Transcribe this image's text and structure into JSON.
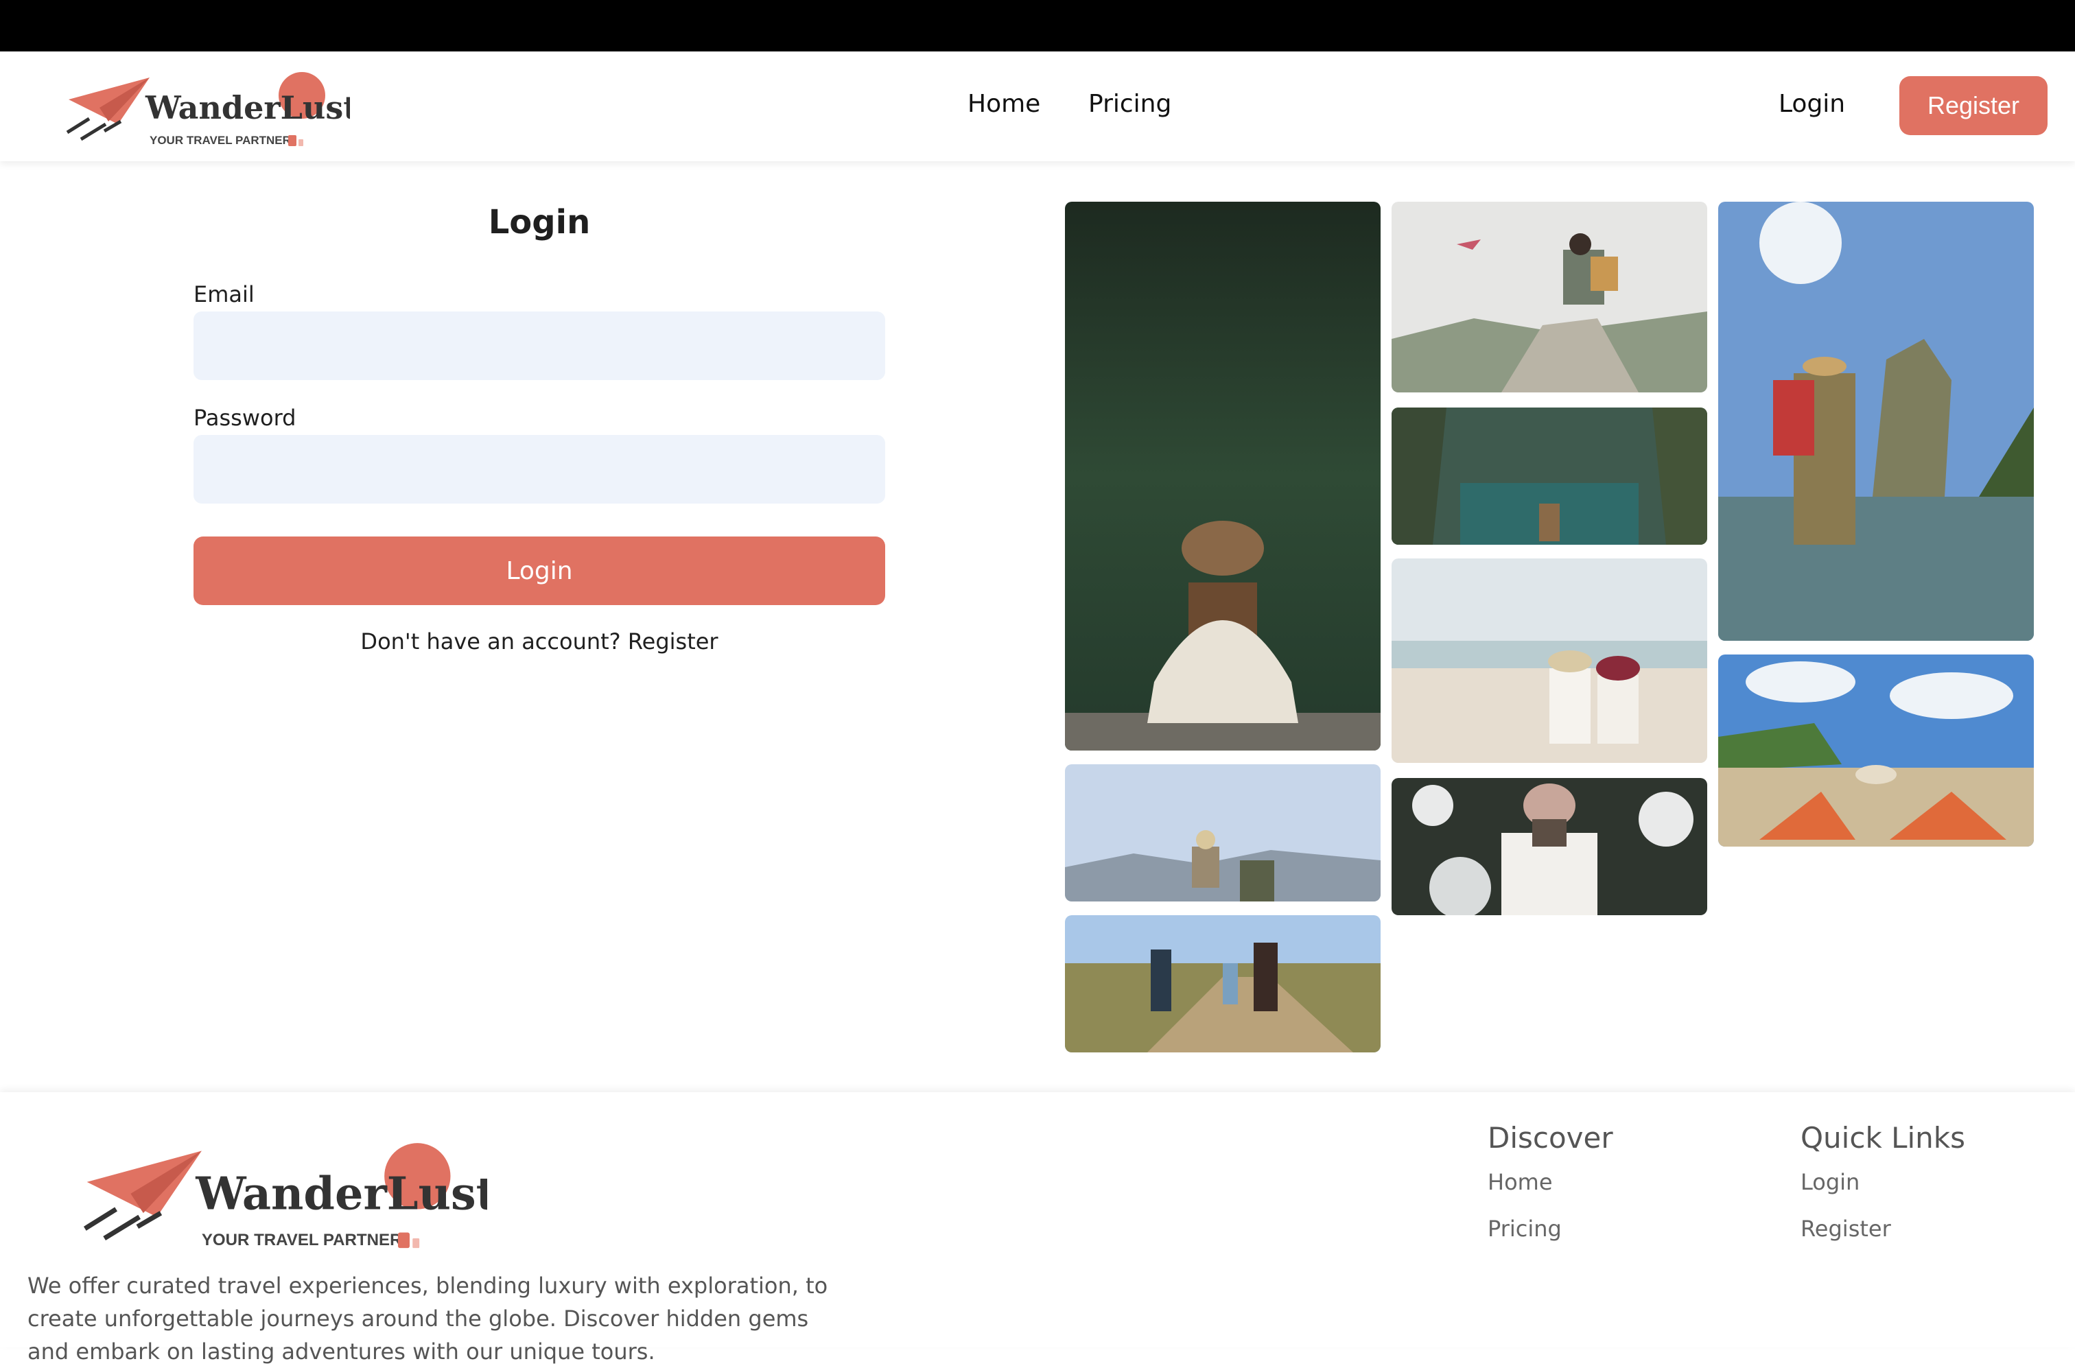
{
  "brand": {
    "name": "WanderLust",
    "tagline": "YOUR TRAVEL PARTNER",
    "accent_color": "#e07262"
  },
  "nav": {
    "home": "Home",
    "pricing": "Pricing",
    "login": "Login",
    "register": "Register"
  },
  "login_form": {
    "title": "Login",
    "email_label": "Email",
    "email_value": "",
    "password_label": "Password",
    "password_value": "",
    "submit_label": "Login",
    "prompt_text": "Don't have an account?",
    "prompt_link": "Register"
  },
  "gallery": {
    "photos": [
      "traveler-forest-lake-photo",
      "hiker-mountain-plane-photo",
      "boat-limestone-bay-photo",
      "couple-beach-photo",
      "backpacker-rock-island-photo",
      "beach-lounge-chairs-photo",
      "arms-raised-mountain-photo",
      "photographer-snow-photo",
      "family-hiking-trail-photo"
    ]
  },
  "footer": {
    "description": "We offer curated travel experiences, blending luxury with exploration, to create unforgettable journeys around the globe. Discover hidden gems and embark on lasting adventures with our unique tours.",
    "discover_heading": "Discover",
    "discover_links": [
      "Home",
      "Pricing"
    ],
    "quick_heading": "Quick Links",
    "quick_links": [
      "Login",
      "Register"
    ]
  }
}
